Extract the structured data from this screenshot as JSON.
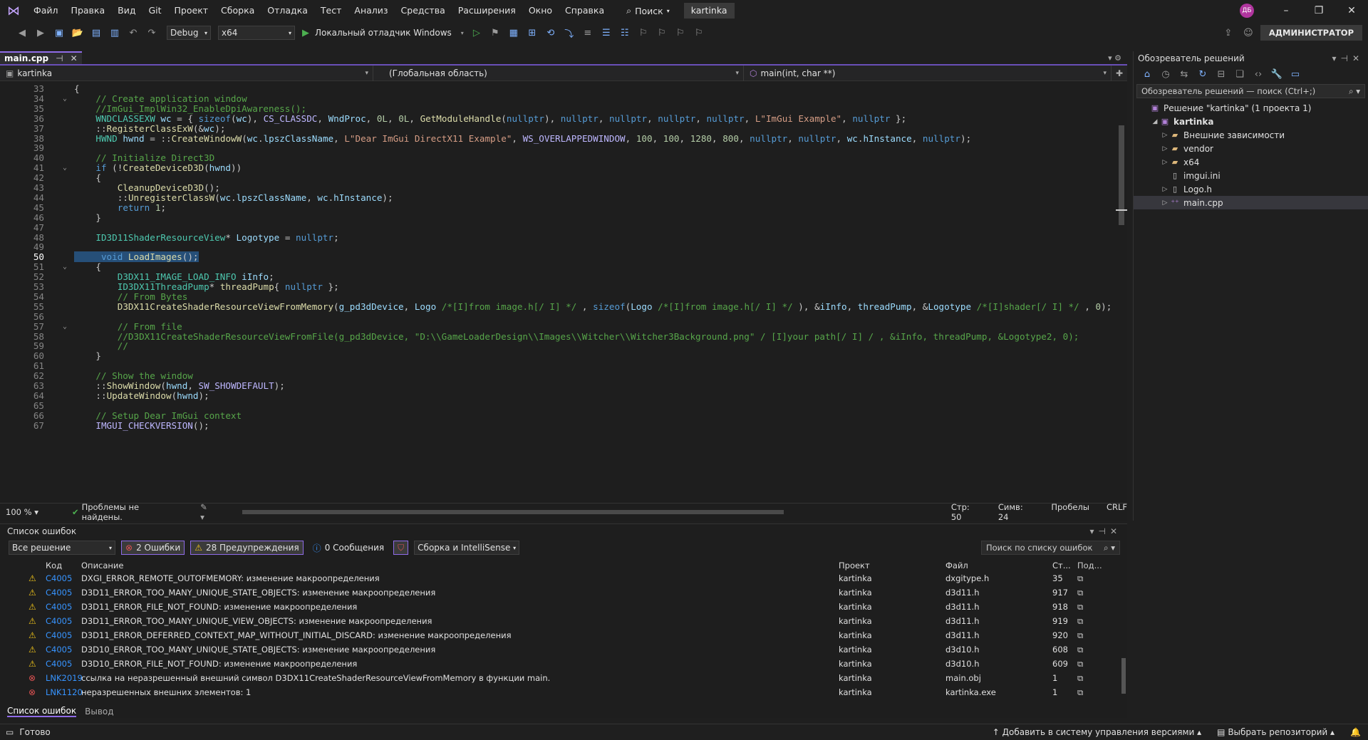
{
  "menu": {
    "items": [
      "Файл",
      "Правка",
      "Вид",
      "Git",
      "Проект",
      "Сборка",
      "Отладка",
      "Тест",
      "Анализ",
      "Средства",
      "Расширения",
      "Окно",
      "Справка"
    ],
    "search_label": "Поиск",
    "solution_name": "kartinka",
    "avatar": "ДБ"
  },
  "toolbar": {
    "config": "Debug",
    "platform": "x64",
    "debugger": "Локальный отладчик Windows",
    "admin": "АДМИНИСТРАТОР"
  },
  "editor": {
    "tab": "main.cpp",
    "nav_project": "kartinka",
    "nav_scope": "(Глобальная область)",
    "nav_member": "main(int, char **)",
    "zoom": "100 %",
    "problems": "Проблемы не найдены.",
    "line_label": "Стр: 50",
    "col_label": "Симв: 24",
    "spaces": "Пробелы",
    "eol": "CRLF",
    "current_line": 50,
    "lines": [
      {
        "n": 33,
        "t": "{"
      },
      {
        "n": 34,
        "t": "    // Create application window"
      },
      {
        "n": 35,
        "t": "    //ImGui_ImplWin32_EnableDpiAwareness();"
      },
      {
        "n": 36,
        "t": "    WNDCLASSEXW wc = { sizeof(wc), CS_CLASSDC, WndProc, 0L, 0L, GetModuleHandle(nullptr), nullptr, nullptr, nullptr, nullptr, L\"ImGui Example\", nullptr };"
      },
      {
        "n": 37,
        "t": "    ::RegisterClassExW(&wc);"
      },
      {
        "n": 38,
        "t": "    HWND hwnd = ::CreateWindowW(wc.lpszClassName, L\"Dear ImGui DirectX11 Example\", WS_OVERLAPPEDWINDOW, 100, 100, 1280, 800, nullptr, nullptr, wc.hInstance, nullptr);"
      },
      {
        "n": 39,
        "t": ""
      },
      {
        "n": 40,
        "t": "    // Initialize Direct3D"
      },
      {
        "n": 41,
        "t": "    if (!CreateDeviceD3D(hwnd))"
      },
      {
        "n": 42,
        "t": "    {"
      },
      {
        "n": 43,
        "t": "        CleanupDeviceD3D();"
      },
      {
        "n": 44,
        "t": "        ::UnregisterClassW(wc.lpszClassName, wc.hInstance);"
      },
      {
        "n": 45,
        "t": "        return 1;"
      },
      {
        "n": 46,
        "t": "    }"
      },
      {
        "n": 47,
        "t": ""
      },
      {
        "n": 48,
        "t": "    ID3D11ShaderResourceView* Logotype = nullptr;"
      },
      {
        "n": 49,
        "t": ""
      },
      {
        "n": 50,
        "t": "     void LoadImages();"
      },
      {
        "n": 51,
        "t": "    {"
      },
      {
        "n": 52,
        "t": "        D3DX11_IMAGE_LOAD_INFO iInfo;"
      },
      {
        "n": 53,
        "t": "        ID3DX11ThreadPump* threadPump{ nullptr };"
      },
      {
        "n": 54,
        "t": "        // From Bytes"
      },
      {
        "n": 55,
        "t": "        D3DX11CreateShaderResourceViewFromMemory(g_pd3dDevice, Logo /*[I]from image.h[/ I] */ , sizeof(Logo /*[I]from image.h[/ I] */ ), &iInfo, threadPump, &Logotype /*[I]shader[/ I] */ , 0);"
      },
      {
        "n": 56,
        "t": ""
      },
      {
        "n": 57,
        "t": "        // From file"
      },
      {
        "n": 58,
        "t": "        //D3DX11CreateShaderResourceViewFromFile(g_pd3dDevice, \"D:\\\\GameLoaderDesign\\\\Images\\\\Witcher\\\\Witcher3Background.png\" / [I]your path[/ I] / , &iInfo, threadPump, &Logotype2, 0);"
      },
      {
        "n": 59,
        "t": "        //"
      },
      {
        "n": 60,
        "t": "    }"
      },
      {
        "n": 61,
        "t": ""
      },
      {
        "n": 62,
        "t": "    // Show the window"
      },
      {
        "n": 63,
        "t": "    ::ShowWindow(hwnd, SW_SHOWDEFAULT);"
      },
      {
        "n": 64,
        "t": "    ::UpdateWindow(hwnd);"
      },
      {
        "n": 65,
        "t": ""
      },
      {
        "n": 66,
        "t": "    // Setup Dear ImGui context"
      },
      {
        "n": 67,
        "t": "    IMGUI_CHECKVERSION();"
      }
    ]
  },
  "solution_explorer": {
    "title": "Обозреватель решений",
    "search_placeholder": "Обозреватель решений — поиск (Ctrl+;)",
    "items": [
      {
        "label": "Решение \"kartinka\" (1 проекта 1)",
        "level": 0,
        "arrow": "",
        "icon": "solution-icon"
      },
      {
        "label": "kartinka",
        "level": 1,
        "arrow": "◢",
        "icon": "project-icon",
        "bold": true
      },
      {
        "label": "Внешние зависимости",
        "level": 2,
        "arrow": "▷",
        "icon": "folder-icon"
      },
      {
        "label": "vendor",
        "level": 2,
        "arrow": "▷",
        "icon": "folder-icon"
      },
      {
        "label": "x64",
        "level": 2,
        "arrow": "▷",
        "icon": "folder-icon"
      },
      {
        "label": "imgui.ini",
        "level": 2,
        "arrow": "",
        "icon": "file-icon"
      },
      {
        "label": "Logo.h",
        "level": 2,
        "arrow": "▷",
        "icon": "header-icon"
      },
      {
        "label": "main.cpp",
        "level": 2,
        "arrow": "▷",
        "icon": "cpp-icon",
        "selected": true
      }
    ]
  },
  "error_list": {
    "title": "Список ошибок",
    "scope": "Все решение",
    "errors_btn": "2 Ошибки",
    "warnings_btn": "28 Предупреждения",
    "messages_btn": "0 Сообщения",
    "build_filter": "Сборка и IntelliSense",
    "search_placeholder": "Поиск по списку ошибок",
    "columns": [
      "Код",
      "Описание",
      "Проект",
      "Файл",
      "Ст...",
      "Под..."
    ],
    "rows": [
      {
        "type": "warn",
        "code": "C4005",
        "desc": "DXGI_ERROR_REMOTE_OUTOFMEMORY: изменение макроопределения",
        "project": "kartinka",
        "file": "dxgitype.h",
        "line": "35"
      },
      {
        "type": "warn",
        "code": "C4005",
        "desc": "D3D11_ERROR_TOO_MANY_UNIQUE_STATE_OBJECTS: изменение макроопределения",
        "project": "kartinka",
        "file": "d3d11.h",
        "line": "917"
      },
      {
        "type": "warn",
        "code": "C4005",
        "desc": "D3D11_ERROR_FILE_NOT_FOUND: изменение макроопределения",
        "project": "kartinka",
        "file": "d3d11.h",
        "line": "918"
      },
      {
        "type": "warn",
        "code": "C4005",
        "desc": "D3D11_ERROR_TOO_MANY_UNIQUE_VIEW_OBJECTS: изменение макроопределения",
        "project": "kartinka",
        "file": "d3d11.h",
        "line": "919"
      },
      {
        "type": "warn",
        "code": "C4005",
        "desc": "D3D11_ERROR_DEFERRED_CONTEXT_MAP_WITHOUT_INITIAL_DISCARD: изменение макроопределения",
        "project": "kartinka",
        "file": "d3d11.h",
        "line": "920"
      },
      {
        "type": "warn",
        "code": "C4005",
        "desc": "D3D10_ERROR_TOO_MANY_UNIQUE_STATE_OBJECTS: изменение макроопределения",
        "project": "kartinka",
        "file": "d3d10.h",
        "line": "608"
      },
      {
        "type": "warn",
        "code": "C4005",
        "desc": "D3D10_ERROR_FILE_NOT_FOUND: изменение макроопределения",
        "project": "kartinka",
        "file": "d3d10.h",
        "line": "609"
      },
      {
        "type": "err",
        "code": "LNK2019",
        "desc": "ссылка на неразрешенный внешний символ D3DX11CreateShaderResourceViewFromMemory в функции main.",
        "project": "kartinka",
        "file": "main.obj",
        "line": "1"
      },
      {
        "type": "err",
        "code": "LNK1120",
        "desc": "неразрешенных внешних элементов: 1",
        "project": "kartinka",
        "file": "kartinka.exe",
        "line": "1"
      }
    ],
    "tab_errors": "Список ошибок",
    "tab_output": "Вывод"
  },
  "status": {
    "ready": "Готово",
    "add_vcs": "Добавить в систему управления версиями",
    "select_repo": "Выбрать репозиторий"
  }
}
